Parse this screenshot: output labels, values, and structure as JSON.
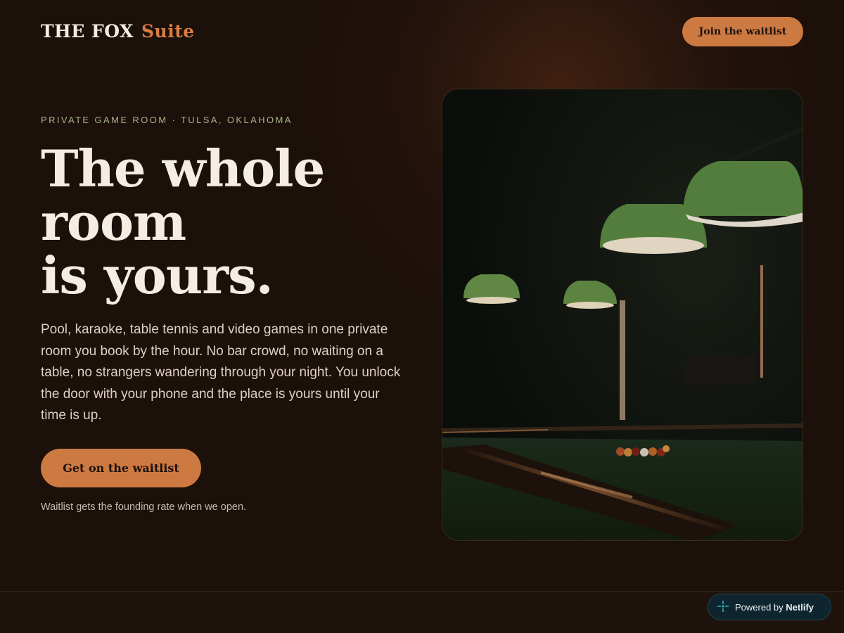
{
  "brand": {
    "name": "THE FOX",
    "suffix": "Suite"
  },
  "nav": {
    "waitlist_button": "Join the waitlist"
  },
  "hero": {
    "eyebrow": "PRIVATE GAME ROOM · TULSA, OKLAHOMA",
    "headline_lines": [
      "The whole",
      "room",
      "is yours."
    ],
    "body": "Pool, karaoke, table tennis and video games in one private room you book by the hour. No bar crowd, no waiting on a table, no strangers wandering through your night. You unlock the door with your phone and the place is yours until your time is up.",
    "cta_label": "Get on the waitlist",
    "note": "Waitlist gets the founding rate when we open."
  },
  "badge": {
    "prefix": "Powered by",
    "brand": "Netlify",
    "icon": "netlify-icon"
  },
  "colors": {
    "background": "#1c100b",
    "accent": "#cd7a42",
    "brand_suffix": "#d77d41",
    "eyebrow": "#a7b488",
    "badge_bg": "#0e2530"
  }
}
